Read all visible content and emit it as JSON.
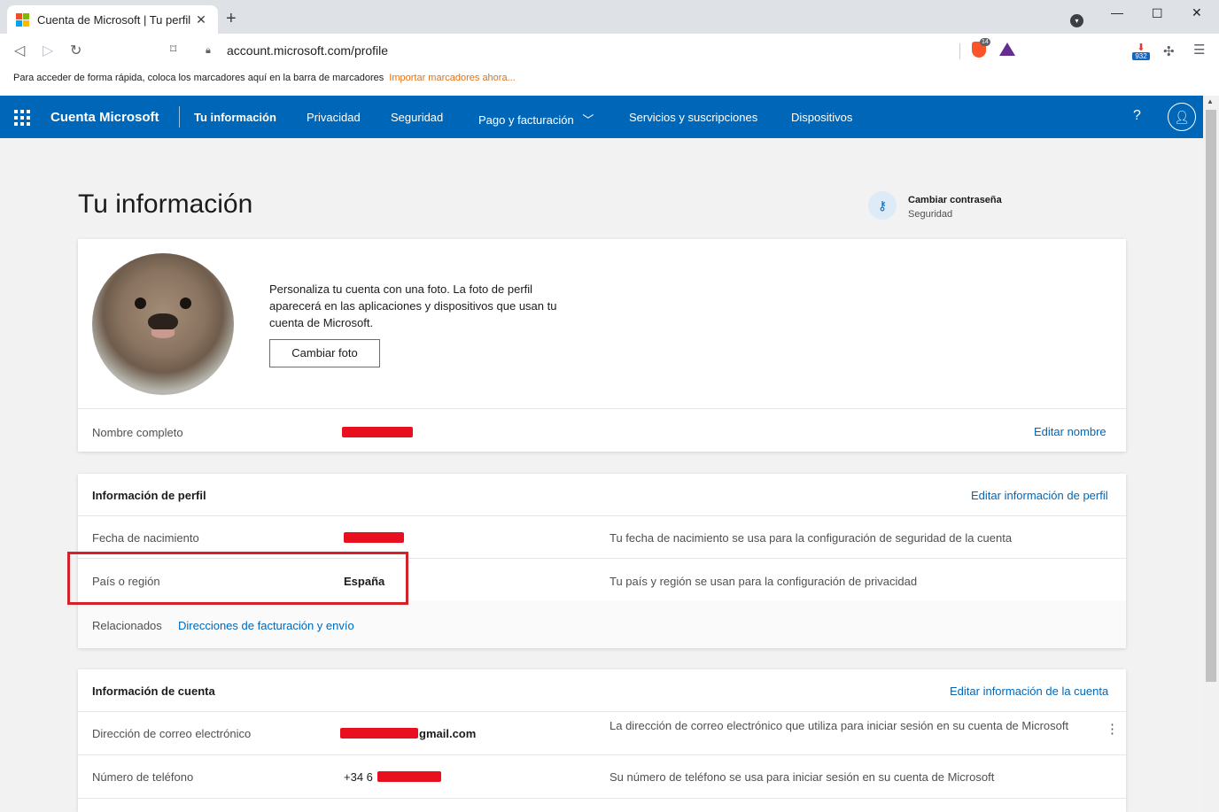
{
  "browser": {
    "tab_title": "Cuenta de Microsoft | Tu perfil",
    "tab_close": "✕",
    "new_tab": "+",
    "url": "account.microsoft.com/profile",
    "brave_badge": "14",
    "download_badge": "932",
    "bookmarks_text": "Para acceder de forma rápida, coloca los marcadores aquí en la barra de marcadores",
    "bookmarks_import": "Importar marcadores ahora...",
    "ms_logo_colors": [
      "#f25022",
      "#7fba00",
      "#00a4ef",
      "#ffb900"
    ]
  },
  "header": {
    "brand": "Cuenta Microsoft",
    "nav": [
      "Tu información",
      "Privacidad",
      "Seguridad",
      "Pago y facturación",
      "Servicios y suscripciones",
      "Dispositivos"
    ],
    "help": "?",
    "accent": "#0067b8"
  },
  "page": {
    "title": "Tu información",
    "change_password": {
      "title": "Cambiar contraseña",
      "subtitle": "Seguridad"
    }
  },
  "photo_card": {
    "text": "Personaliza tu cuenta con una foto. La foto de perfil aparecerá en las aplicaciones y dispositivos que usan tu cuenta de Microsoft.",
    "button": "Cambiar foto",
    "name_label": "Nombre completo",
    "edit_name": "Editar nombre"
  },
  "profile_card": {
    "title": "Información de perfil",
    "edit_link": "Editar información de perfil",
    "rows": [
      {
        "label": "Fecha de nacimiento",
        "value": "",
        "desc": "Tu fecha de nacimiento se usa para la configuración de seguridad de la cuenta"
      },
      {
        "label": "País o región",
        "value": "España",
        "desc": "Tu país y región se usan para la configuración de privacidad"
      }
    ],
    "related_label": "Relacionados",
    "related_link": "Direcciones de facturación y envío"
  },
  "account_card": {
    "title": "Información de cuenta",
    "edit_link": "Editar información de la cuenta",
    "rows": [
      {
        "label": "Dirección de correo electrónico",
        "value": "gmail.com",
        "desc": "La dirección de correo electrónico que utiliza para iniciar sesión en su cuenta de Microsoft"
      },
      {
        "label": "Número de teléfono",
        "value": "+34 6",
        "desc": "Su número de teléfono se usa para iniciar sesión en su cuenta de Microsoft"
      }
    ]
  },
  "colors": {
    "redaction": "#e8101e",
    "highlight": "#d3222a",
    "link": "#0067b8"
  }
}
